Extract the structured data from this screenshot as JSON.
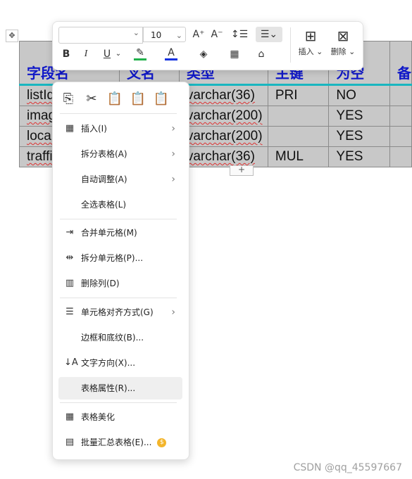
{
  "table": {
    "headers": [
      "字段名",
      "叉名",
      "类型",
      "主键",
      "为空",
      "备"
    ],
    "rows": [
      {
        "field": "listId",
        "type": "varchar(36)",
        "key": "PRI",
        "nullable": "NO"
      },
      {
        "field": "imag",
        "type": "varchar(200)",
        "key": "",
        "nullable": "YES"
      },
      {
        "field": "local",
        "type": "varchar(200)",
        "key": "",
        "nullable": "YES"
      },
      {
        "field": "traffic",
        "type": "varchar(36)",
        "key": "MUL",
        "nullable": "YES"
      }
    ],
    "add_row_label": "+"
  },
  "toolbar": {
    "font_name": "",
    "font_size": "10",
    "increase_font": "A⁺",
    "decrease_font": "A⁻",
    "bold": "B",
    "italic": "I",
    "underline": "U",
    "insert_label": "插入",
    "delete_label": "删除",
    "colors": {
      "highlight": "#22b14c",
      "font": "#1030e0"
    }
  },
  "context_menu": {
    "items": [
      {
        "label": "插入(I)",
        "submenu": true
      },
      {
        "label": "拆分表格(A)",
        "submenu": true
      },
      {
        "label": "自动调整(A)",
        "submenu": true
      },
      {
        "label": "全选表格(L)",
        "submenu": false
      },
      {
        "label": "合并单元格(M)",
        "submenu": false
      },
      {
        "label": "拆分单元格(P)...",
        "submenu": false
      },
      {
        "label": "删除列(D)",
        "submenu": false
      },
      {
        "label": "单元格对齐方式(G)",
        "submenu": true
      },
      {
        "label": "边框和底纹(B)...",
        "submenu": false
      },
      {
        "label": "文字方向(X)...",
        "submenu": false
      },
      {
        "label": "表格属性(R)...",
        "submenu": false
      },
      {
        "label": "表格美化",
        "submenu": false
      },
      {
        "label": "批量汇总表格(E)...",
        "submenu": false
      }
    ],
    "premium_badge": "$"
  },
  "watermark": "CSDN @qq_45597667"
}
